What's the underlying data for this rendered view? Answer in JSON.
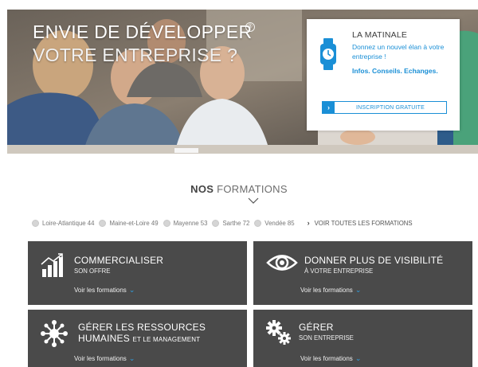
{
  "hero": {
    "title_line1": "ENVIE DE DÉVELOPPER",
    "title_line2": "VOTRE ENTREPRISE ?"
  },
  "promo": {
    "icon": "smartwatch-icon",
    "title": "LA MATINALE",
    "text": "Donnez un nouvel élan à votre entreprise !",
    "tags": "Infos. Conseils. Echanges.",
    "button_label": "INSCRIPTION GRATUITE",
    "accent_color": "#1a8fd6"
  },
  "formations": {
    "title_strong": "NOS",
    "title_light": "FORMATIONS",
    "regions": [
      {
        "label": "Loire-Atlantique 44"
      },
      {
        "label": "Maine-et-Loire 49"
      },
      {
        "label": "Mayenne 53"
      },
      {
        "label": "Sarthe 72"
      },
      {
        "label": "Vendée 85"
      }
    ],
    "all_link": "VOIR TOUTES LES FORMATIONS"
  },
  "cards": [
    {
      "title": "COMMERCIALISER",
      "subtitle": "SON OFFRE",
      "link": "Voir les formations",
      "icon": "growth-chart-icon"
    },
    {
      "title": "DONNER PLUS DE VISIBILITÉ",
      "subtitle": "À VOTRE ENTREPRISE",
      "link": "Voir les formations",
      "icon": "eye-icon"
    },
    {
      "title_line1": "GÉRER LES RESSOURCES",
      "title_line2": "HUMAINES",
      "title_small": "ET LE MANAGEMENT",
      "link": "Voir les formations",
      "icon": "team-network-icon"
    },
    {
      "title": "GÉRER",
      "subtitle": "SON ENTREPRISE",
      "link": "Voir les formations",
      "icon": "gears-icon"
    }
  ],
  "colors": {
    "card_bg": "#4a4a4a",
    "link_arrow": "#2ea3e6"
  }
}
